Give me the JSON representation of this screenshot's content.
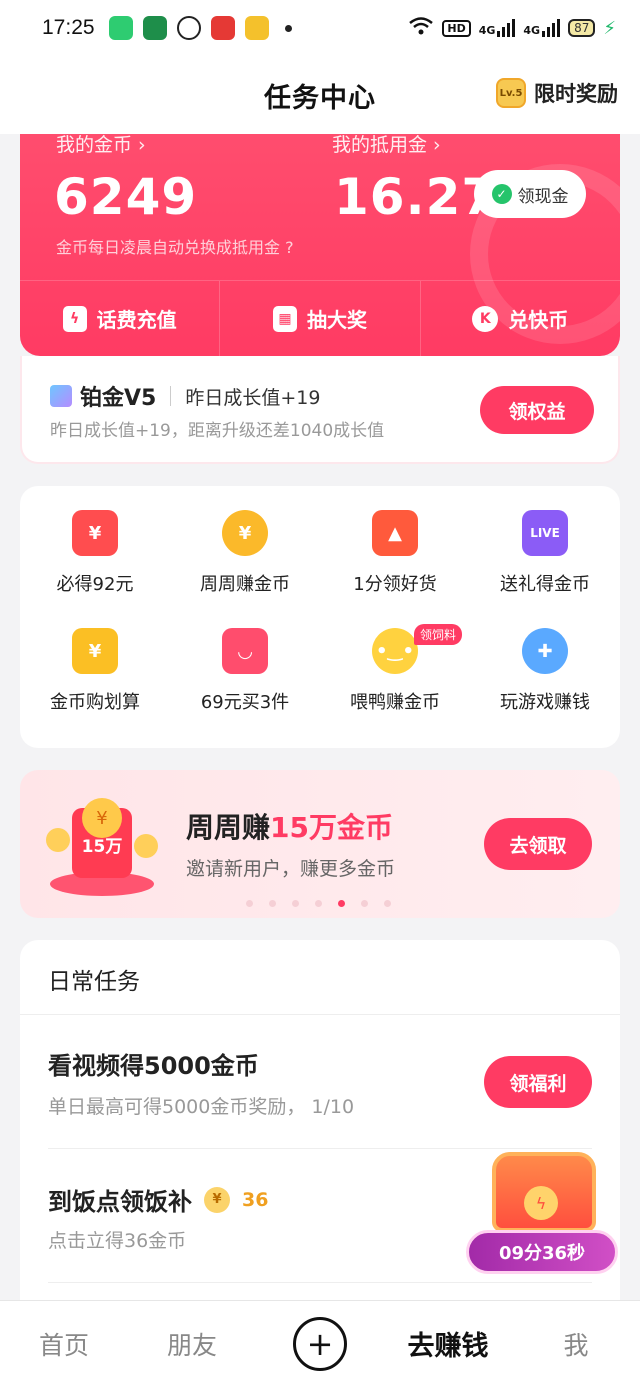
{
  "status_bar": {
    "time": "17:25",
    "hd_label": "HD",
    "net1": "4G",
    "net2": "4G",
    "battery": "87"
  },
  "header": {
    "title": "任务中心",
    "level_badge": "Lv.5",
    "reward_label": "限时奖励"
  },
  "wallet": {
    "coins_label": "我的金币 ›",
    "coins_value": "6249",
    "cash_label": "我的抵用金 ›",
    "cash_value": "16.27",
    "withdraw_button": "领现金",
    "note": "金币每日凌晨自动兑换成抵用金 ?",
    "actions": [
      {
        "icon": "lightning-icon",
        "label": "话费充值"
      },
      {
        "icon": "gift-icon",
        "label": "抽大奖"
      },
      {
        "icon": "k-coin-icon",
        "label": "兑快币"
      }
    ]
  },
  "vip": {
    "title": "铂金V5",
    "growth": "昨日成长值+19",
    "note": "昨日成长值+19，距离升级还差1040成长值",
    "button": "领权益"
  },
  "grid": [
    {
      "icon": "red-envelope-icon",
      "label": "必得92元",
      "color": "#ff4d4f",
      "glyph": "¥"
    },
    {
      "icon": "coin-icon",
      "label": "周周赚金币",
      "color": "#fbb92a",
      "glyph": "¥"
    },
    {
      "icon": "flame-icon",
      "label": "1分领好货",
      "color": "#ff5a3c",
      "glyph": "▲"
    },
    {
      "icon": "live-icon",
      "label": "送礼得金币",
      "color": "#8b5cf6",
      "glyph": "LIVE"
    },
    {
      "icon": "money-bag-icon",
      "label": "金币购划算",
      "color": "#fbbf24",
      "glyph": "¥"
    },
    {
      "icon": "shopping-gift-icon",
      "label": "69元买3件",
      "color": "#ff4d6d",
      "glyph": "◡"
    },
    {
      "icon": "duck-icon",
      "label": "喂鸭赚金币",
      "color": "#ffd23f",
      "glyph": "•‿•",
      "tag": "领饲料"
    },
    {
      "icon": "gamepad-icon",
      "label": "玩游戏赚钱",
      "color": "#5aa9ff",
      "glyph": "✚"
    }
  ],
  "banner": {
    "title_prefix": "周周赚",
    "title_highlight": "15万金币",
    "subtitle": "邀请新用户，赚更多金币",
    "art_label": "15万",
    "button": "去领取",
    "dots": 7,
    "active_dot": 4
  },
  "tasks": {
    "header": "日常任务",
    "items": [
      {
        "title": "看视频得5000金币",
        "subtitle": "单日最高可得5000金币奖励，  1/10",
        "button": "领福利"
      },
      {
        "title": "到饭点领饭补",
        "reward": "36",
        "subtitle": "点击立得36金币"
      }
    ]
  },
  "chest": {
    "timer": "09分36秒"
  },
  "tabbar": {
    "tabs": [
      "首页",
      "朋友",
      "+",
      "去赚钱",
      "我"
    ],
    "active": "去赚钱"
  },
  "colors": {
    "accent": "#ff3b63",
    "gold": "#f0a020"
  }
}
